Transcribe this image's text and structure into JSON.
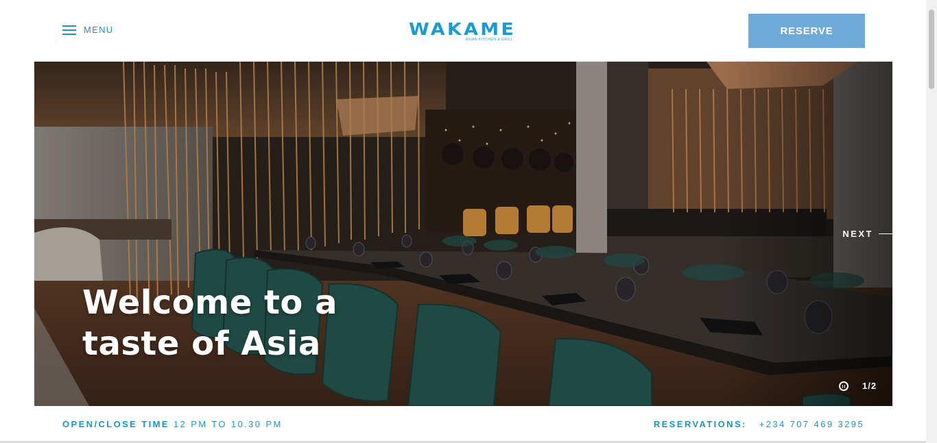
{
  "header": {
    "menu_label": "MENU",
    "logo_word": "WAKAME",
    "logo_subtitle": "ASIAN KITCHEN & GRILL",
    "reserve_label": "RESERVE"
  },
  "hero": {
    "title_line1": "Welcome to a",
    "title_line2": "taste of Asia",
    "next_label": "NEXT",
    "slide_counter": "1/2"
  },
  "info": {
    "hours_label": "OPEN/CLOSE TIME",
    "hours_value": "12 PM TO 10.30 PM",
    "reservations_label": "RESERVATIONS:",
    "reservations_phone": "+234 707 469 3295"
  },
  "colors": {
    "brand_blue": "#1d93c4",
    "reserve_button": "#6ea9d8"
  },
  "icons": [
    "hamburger-icon",
    "pause-icon"
  ]
}
